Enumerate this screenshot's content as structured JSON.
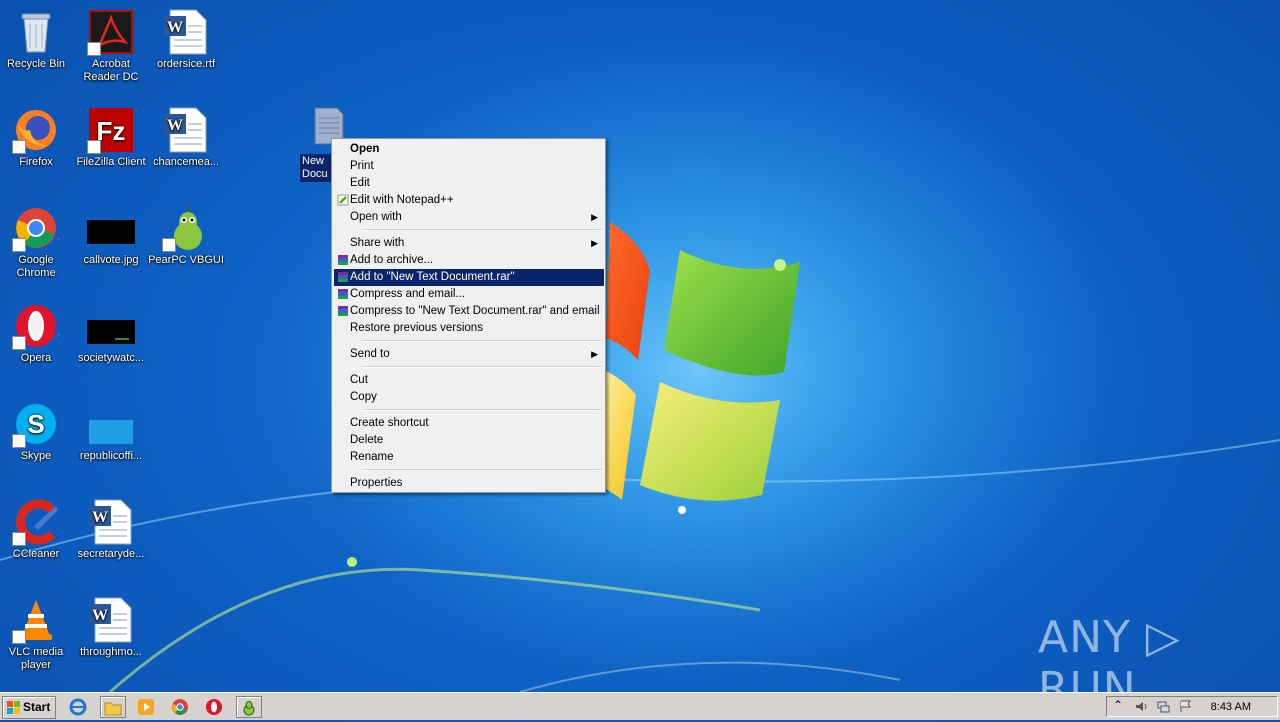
{
  "desktop": {
    "icons": [
      {
        "label": "Recycle Bin"
      },
      {
        "label": "Acrobat Reader DC"
      },
      {
        "label": "ordersice.rtf"
      },
      {
        "label": "Firefox"
      },
      {
        "label": "FileZilla Client"
      },
      {
        "label": "chancemea..."
      },
      {
        "label": "Google Chrome"
      },
      {
        "label": "callvote.jpg"
      },
      {
        "label": "PearPC VBGUI"
      },
      {
        "label": "Opera"
      },
      {
        "label": "societywatc..."
      },
      {
        "label": "Skype"
      },
      {
        "label": "republicoffi..."
      },
      {
        "label": "CCleaner"
      },
      {
        "label": "secretaryde..."
      },
      {
        "label": "VLC media player"
      },
      {
        "label": "throughmo..."
      }
    ],
    "selected_file_label": "New Docu"
  },
  "context_menu": {
    "items": [
      {
        "label": "Open",
        "bold": true
      },
      {
        "label": "Print"
      },
      {
        "label": "Edit"
      },
      {
        "label": "Edit with Notepad++",
        "icon": "notepadpp-icon"
      },
      {
        "label": "Open with",
        "submenu": true
      },
      {
        "label": "Share with",
        "submenu": true
      },
      {
        "label": "Add to archive...",
        "icon": "winrar-icon"
      },
      {
        "label": "Add to \"New Text Document.rar\"",
        "icon": "winrar-icon",
        "highlighted": true
      },
      {
        "label": "Compress and email...",
        "icon": "winrar-icon"
      },
      {
        "label": "Compress to \"New Text Document.rar\" and email",
        "icon": "winrar-icon"
      },
      {
        "label": "Restore previous versions"
      },
      {
        "label": "Send to",
        "submenu": true
      },
      {
        "label": "Cut"
      },
      {
        "label": "Copy"
      },
      {
        "label": "Create shortcut"
      },
      {
        "label": "Delete"
      },
      {
        "label": "Rename"
      },
      {
        "label": "Properties"
      }
    ],
    "submenu_arrow": "▶"
  },
  "taskbar": {
    "start_label": "Start",
    "clock": "8:43 AM",
    "tray_expand": "⌃"
  },
  "watermark": "ANY ▷ RUN",
  "colors": {
    "highlight": "#0a246a",
    "desktop": "#1b78d8",
    "taskbar": "#d6d3ce"
  }
}
